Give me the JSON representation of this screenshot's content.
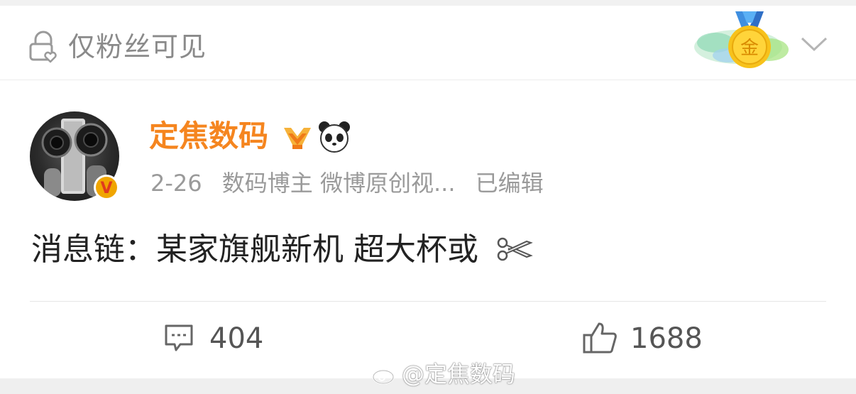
{
  "visibility": {
    "label": "仅粉丝可见"
  },
  "author": {
    "name": "定焦数码",
    "date": "2-26",
    "tags": "数码博主 微博原创视...",
    "edited": "已编辑",
    "verified_badge": "V"
  },
  "medal": {
    "text": "金"
  },
  "post": {
    "text": "消息链：某家旗舰新机 超大杯或"
  },
  "actions": {
    "comments": "404",
    "likes": "1688"
  },
  "watermark": {
    "text": "@定焦数码"
  },
  "colors": {
    "name": "#f5851f",
    "muted": "#9a9a9a",
    "text": "#222222",
    "badge": "#f0a500"
  },
  "icons": [
    "lock-heart-icon",
    "gold-medal-icon",
    "chevron-down-icon",
    "vip-crown-icon",
    "panda-icon",
    "scissors-icon",
    "comment-icon",
    "thumbs-up-icon",
    "weibo-logo"
  ]
}
